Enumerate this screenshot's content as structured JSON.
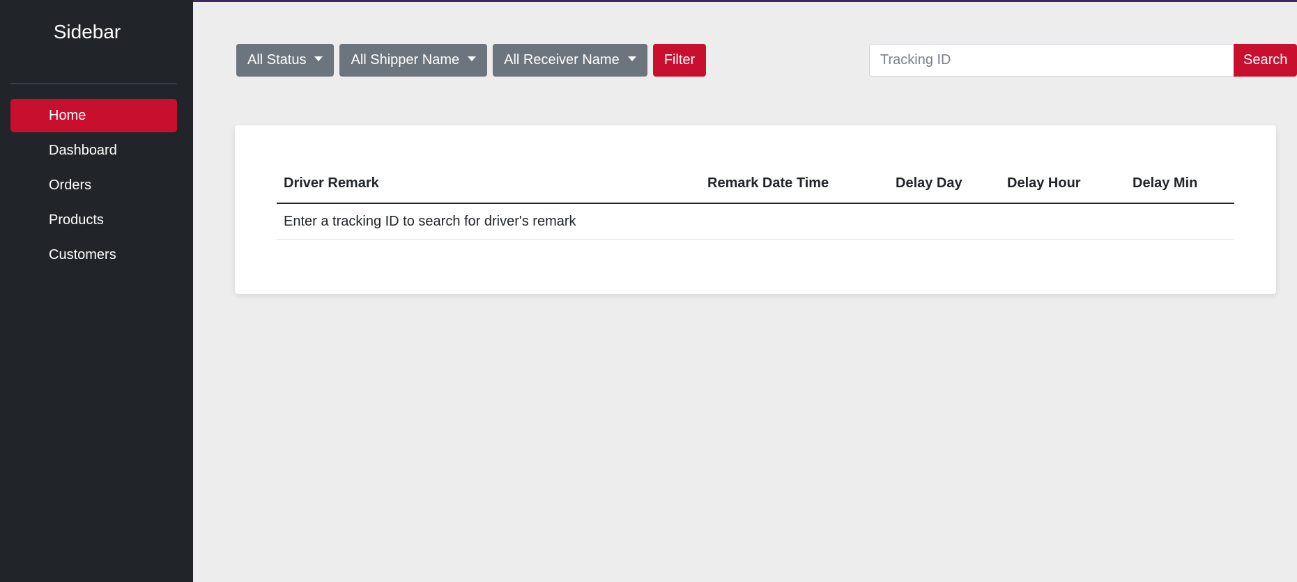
{
  "sidebar": {
    "title": "Sidebar",
    "items": [
      {
        "label": "Home",
        "active": true
      },
      {
        "label": "Dashboard"
      },
      {
        "label": "Orders"
      },
      {
        "label": "Products"
      },
      {
        "label": "Customers"
      }
    ]
  },
  "toolbar": {
    "status_dropdown": "All Status",
    "shipper_dropdown": "All Shipper Name",
    "receiver_dropdown": "All Receiver Name",
    "filter_label": "Filter"
  },
  "search": {
    "placeholder": "Tracking ID",
    "value": "",
    "button_label": "Search"
  },
  "table": {
    "columns": [
      "Driver Remark",
      "Remark Date Time",
      "Delay Day",
      "Delay Hour",
      "Delay Min"
    ],
    "empty_message": "Enter a tracking ID to search for driver's remark"
  },
  "colors": {
    "accent": "#c8102e",
    "sidebar_bg": "#212529",
    "dropdown_bg": "#6c757d",
    "page_bg": "#ededed"
  }
}
